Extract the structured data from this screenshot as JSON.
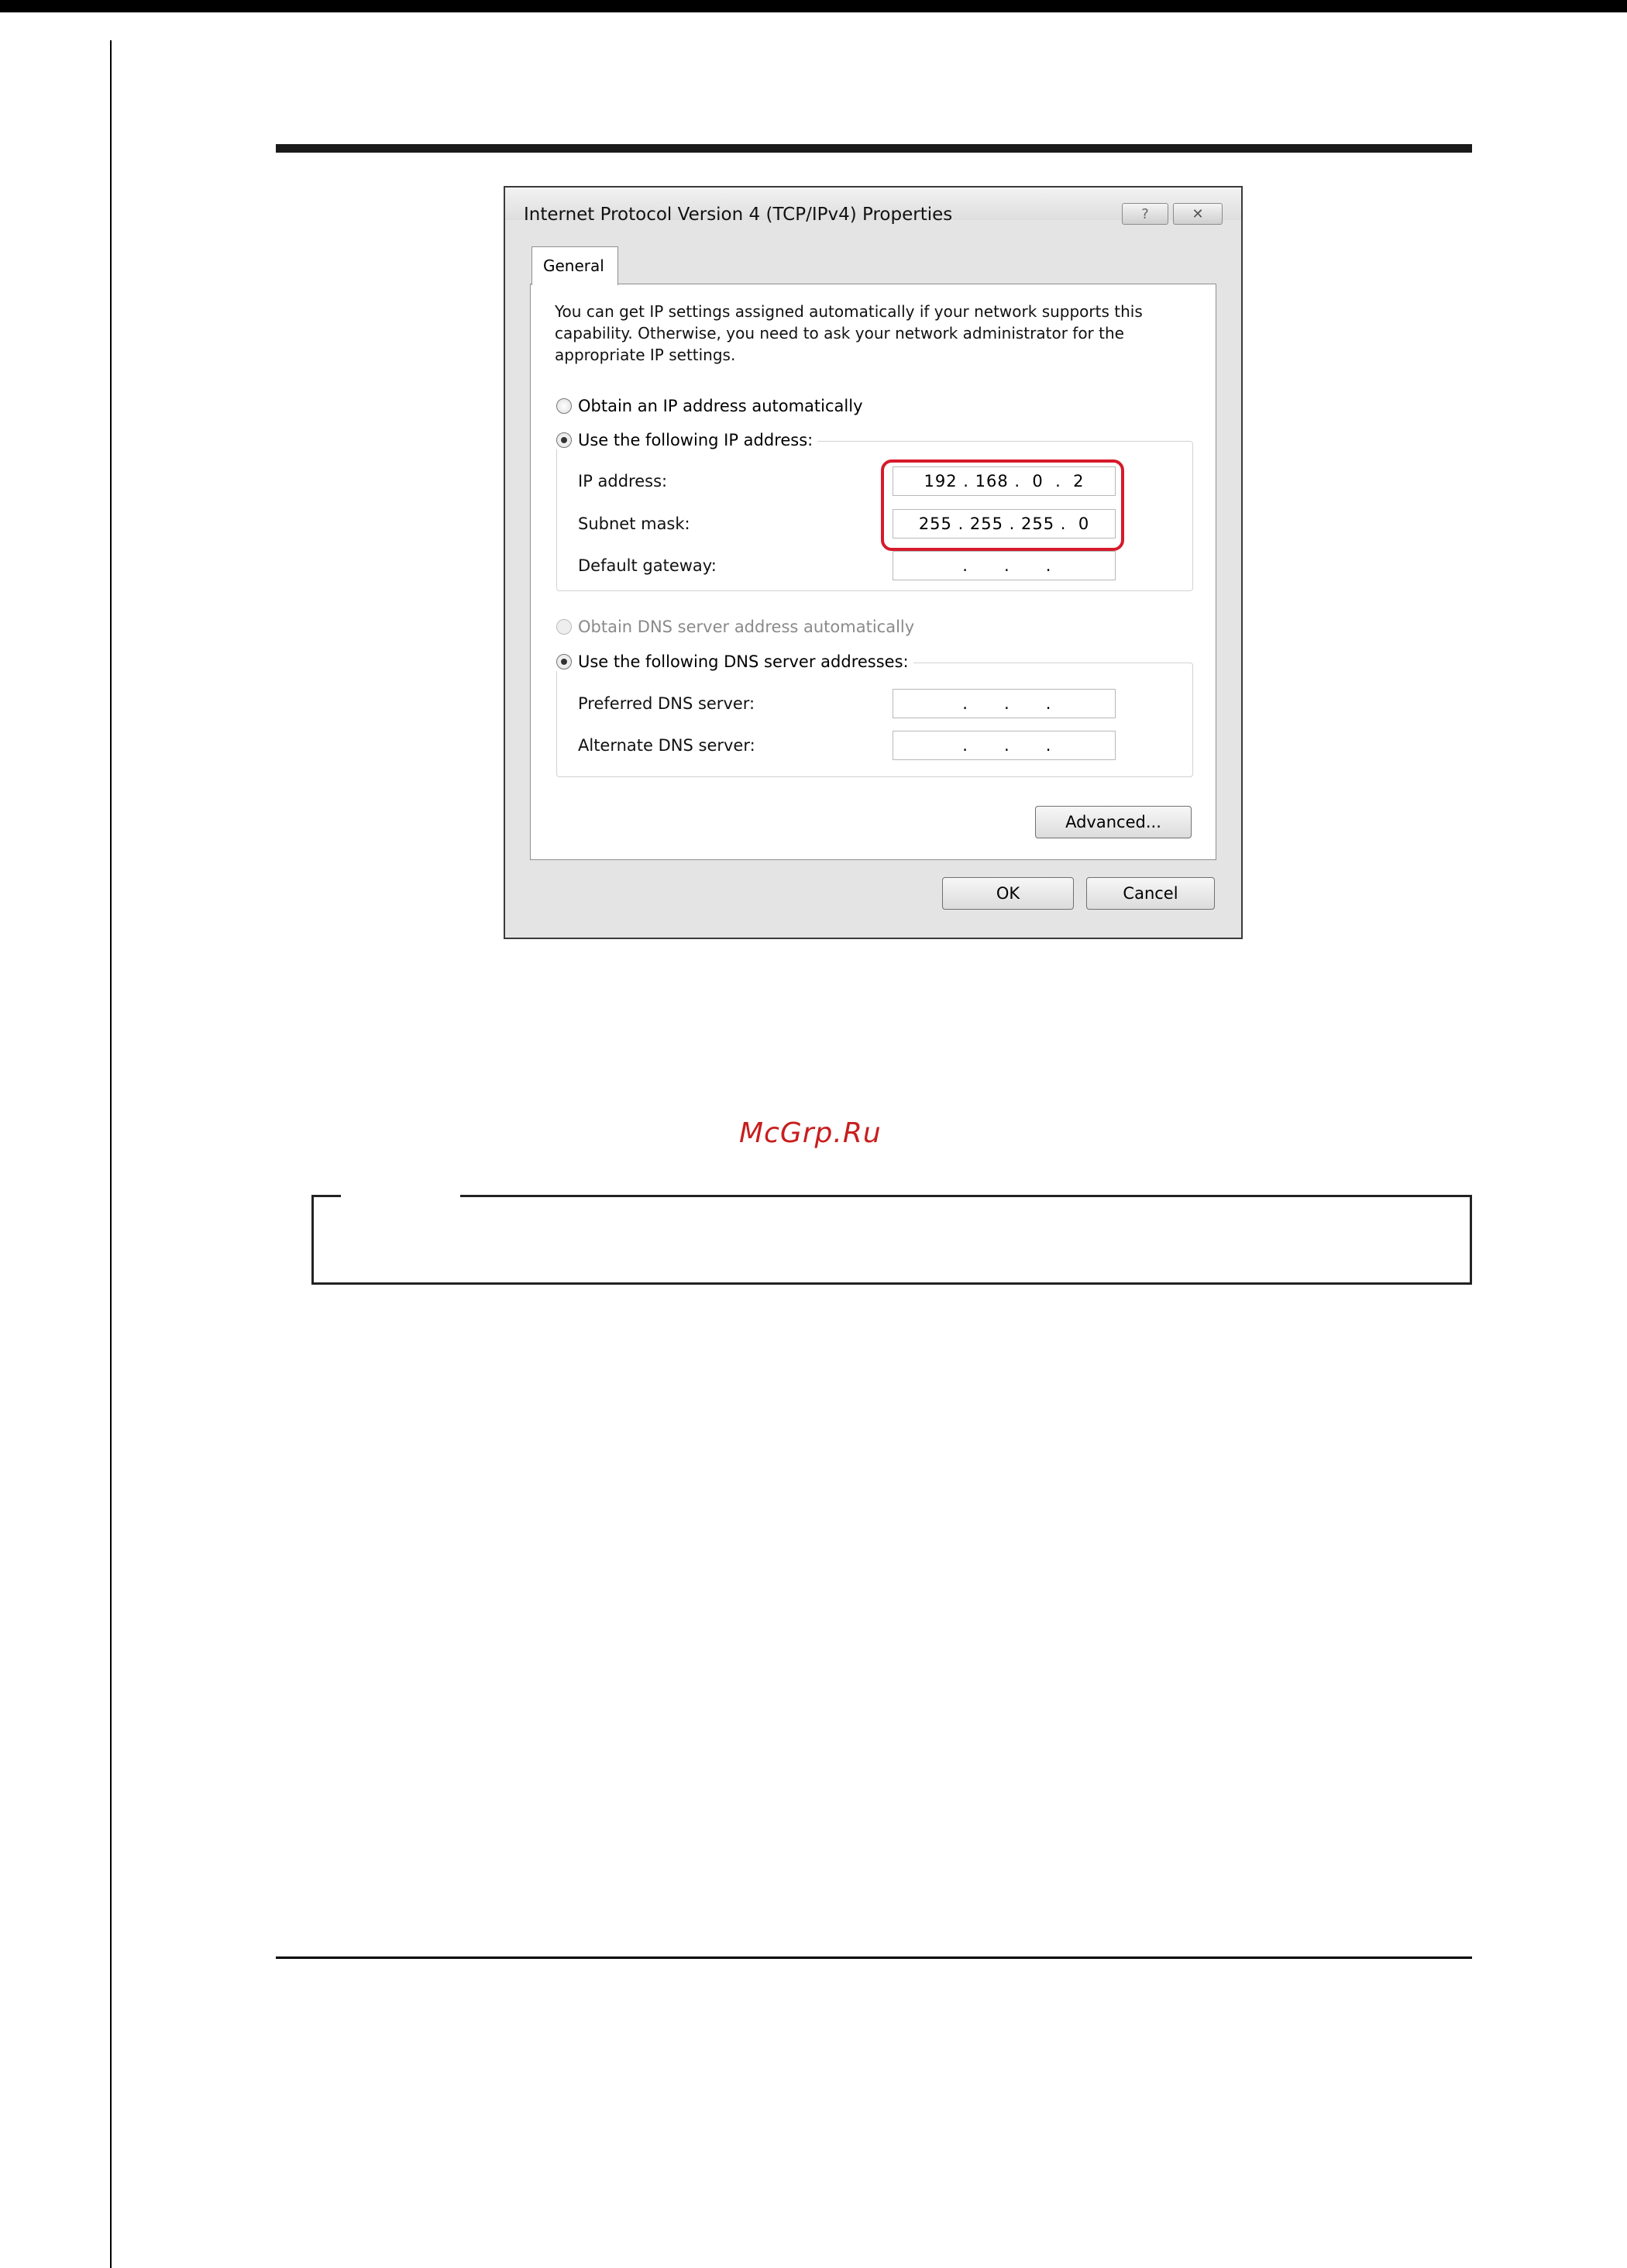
{
  "dialog": {
    "title": "Internet Protocol Version 4 (TCP/IPv4) Properties",
    "help_button": "?",
    "close_button": "✕",
    "tab_label": "General",
    "description": "You can get IP settings assigned automatically if your network supports this capability. Otherwise, you need to ask your network administrator for the appropriate IP settings.",
    "ip_mode": {
      "auto_label": "Obtain an IP address automatically",
      "manual_label": "Use the following IP address:",
      "selected": "manual"
    },
    "ip_fields": [
      {
        "label": "IP address:",
        "value": "192 . 168 .  0  .  2"
      },
      {
        "label": "Subnet mask:",
        "value": "255 . 255 . 255 .  0"
      },
      {
        "label": "Default gateway:",
        "value": " .      .      ."
      }
    ],
    "dns_mode": {
      "auto_label": "Obtain DNS server address automatically",
      "manual_label": "Use the following DNS server addresses:",
      "selected": "manual"
    },
    "dns_fields": [
      {
        "label": "Preferred DNS server:",
        "value": " .      .      ."
      },
      {
        "label": "Alternate DNS server:",
        "value": " .      .      ."
      }
    ],
    "advanced_button": "Advanced...",
    "ok_button": "OK",
    "cancel_button": "Cancel"
  },
  "watermark": "McGrp.Ru",
  "colors": {
    "highlight": "#d61a2a",
    "watermark": "#c81e1e"
  }
}
